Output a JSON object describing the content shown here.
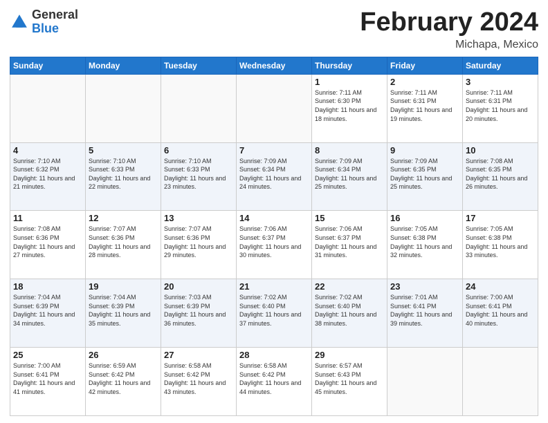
{
  "header": {
    "logo_general": "General",
    "logo_blue": "Blue",
    "month_year": "February 2024",
    "location": "Michapa, Mexico"
  },
  "calendar": {
    "days_of_week": [
      "Sunday",
      "Monday",
      "Tuesday",
      "Wednesday",
      "Thursday",
      "Friday",
      "Saturday"
    ],
    "weeks": [
      [
        {
          "day": null
        },
        {
          "day": null
        },
        {
          "day": null
        },
        {
          "day": null
        },
        {
          "day": 1,
          "sunrise": "7:11 AM",
          "sunset": "6:30 PM",
          "daylight": "11 hours and 18 minutes."
        },
        {
          "day": 2,
          "sunrise": "7:11 AM",
          "sunset": "6:31 PM",
          "daylight": "11 hours and 19 minutes."
        },
        {
          "day": 3,
          "sunrise": "7:11 AM",
          "sunset": "6:31 PM",
          "daylight": "11 hours and 20 minutes."
        }
      ],
      [
        {
          "day": 4,
          "sunrise": "7:10 AM",
          "sunset": "6:32 PM",
          "daylight": "11 hours and 21 minutes."
        },
        {
          "day": 5,
          "sunrise": "7:10 AM",
          "sunset": "6:33 PM",
          "daylight": "11 hours and 22 minutes."
        },
        {
          "day": 6,
          "sunrise": "7:10 AM",
          "sunset": "6:33 PM",
          "daylight": "11 hours and 23 minutes."
        },
        {
          "day": 7,
          "sunrise": "7:09 AM",
          "sunset": "6:34 PM",
          "daylight": "11 hours and 24 minutes."
        },
        {
          "day": 8,
          "sunrise": "7:09 AM",
          "sunset": "6:34 PM",
          "daylight": "11 hours and 25 minutes."
        },
        {
          "day": 9,
          "sunrise": "7:09 AM",
          "sunset": "6:35 PM",
          "daylight": "11 hours and 25 minutes."
        },
        {
          "day": 10,
          "sunrise": "7:08 AM",
          "sunset": "6:35 PM",
          "daylight": "11 hours and 26 minutes."
        }
      ],
      [
        {
          "day": 11,
          "sunrise": "7:08 AM",
          "sunset": "6:36 PM",
          "daylight": "11 hours and 27 minutes."
        },
        {
          "day": 12,
          "sunrise": "7:07 AM",
          "sunset": "6:36 PM",
          "daylight": "11 hours and 28 minutes."
        },
        {
          "day": 13,
          "sunrise": "7:07 AM",
          "sunset": "6:36 PM",
          "daylight": "11 hours and 29 minutes."
        },
        {
          "day": 14,
          "sunrise": "7:06 AM",
          "sunset": "6:37 PM",
          "daylight": "11 hours and 30 minutes."
        },
        {
          "day": 15,
          "sunrise": "7:06 AM",
          "sunset": "6:37 PM",
          "daylight": "11 hours and 31 minutes."
        },
        {
          "day": 16,
          "sunrise": "7:05 AM",
          "sunset": "6:38 PM",
          "daylight": "11 hours and 32 minutes."
        },
        {
          "day": 17,
          "sunrise": "7:05 AM",
          "sunset": "6:38 PM",
          "daylight": "11 hours and 33 minutes."
        }
      ],
      [
        {
          "day": 18,
          "sunrise": "7:04 AM",
          "sunset": "6:39 PM",
          "daylight": "11 hours and 34 minutes."
        },
        {
          "day": 19,
          "sunrise": "7:04 AM",
          "sunset": "6:39 PM",
          "daylight": "11 hours and 35 minutes."
        },
        {
          "day": 20,
          "sunrise": "7:03 AM",
          "sunset": "6:39 PM",
          "daylight": "11 hours and 36 minutes."
        },
        {
          "day": 21,
          "sunrise": "7:02 AM",
          "sunset": "6:40 PM",
          "daylight": "11 hours and 37 minutes."
        },
        {
          "day": 22,
          "sunrise": "7:02 AM",
          "sunset": "6:40 PM",
          "daylight": "11 hours and 38 minutes."
        },
        {
          "day": 23,
          "sunrise": "7:01 AM",
          "sunset": "6:41 PM",
          "daylight": "11 hours and 39 minutes."
        },
        {
          "day": 24,
          "sunrise": "7:00 AM",
          "sunset": "6:41 PM",
          "daylight": "11 hours and 40 minutes."
        }
      ],
      [
        {
          "day": 25,
          "sunrise": "7:00 AM",
          "sunset": "6:41 PM",
          "daylight": "11 hours and 41 minutes."
        },
        {
          "day": 26,
          "sunrise": "6:59 AM",
          "sunset": "6:42 PM",
          "daylight": "11 hours and 42 minutes."
        },
        {
          "day": 27,
          "sunrise": "6:58 AM",
          "sunset": "6:42 PM",
          "daylight": "11 hours and 43 minutes."
        },
        {
          "day": 28,
          "sunrise": "6:58 AM",
          "sunset": "6:42 PM",
          "daylight": "11 hours and 44 minutes."
        },
        {
          "day": 29,
          "sunrise": "6:57 AM",
          "sunset": "6:43 PM",
          "daylight": "11 hours and 45 minutes."
        },
        {
          "day": null
        },
        {
          "day": null
        }
      ]
    ]
  }
}
